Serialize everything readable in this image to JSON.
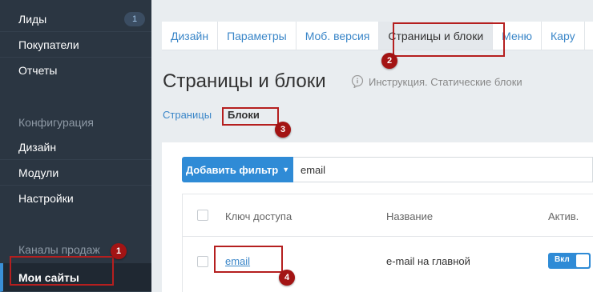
{
  "sidebar": {
    "items": [
      {
        "label": "Лиды",
        "badge": "1"
      },
      {
        "label": "Покупатели"
      },
      {
        "label": "Отчеты"
      },
      {
        "label": "Конфигурация"
      },
      {
        "label": "Дизайн"
      },
      {
        "label": "Модули"
      },
      {
        "label": "Настройки"
      },
      {
        "label": "Каналы продаж"
      },
      {
        "label": "Мои сайты"
      }
    ]
  },
  "tabs": [
    "Дизайн",
    "Параметры",
    "Моб. версия",
    "Страницы и блоки",
    "Меню",
    "Кару"
  ],
  "page": {
    "title": "Страницы и блоки",
    "help_text": "Инструкция. Статические блоки"
  },
  "subtabs": {
    "pages": "Страницы",
    "blocks": "Блоки"
  },
  "filter": {
    "button_label": "Добавить фильтр",
    "value": "email"
  },
  "table": {
    "headers": {
      "key": "Ключ доступа",
      "name": "Название",
      "active": "Актив."
    },
    "rows": [
      {
        "key": "email",
        "name": "e-mail на главной",
        "active_label": "Вкл"
      }
    ]
  },
  "annotations": {
    "m1": "1",
    "m2": "2",
    "m3": "3",
    "m4": "4"
  },
  "colors": {
    "accent": "#2f8bd6",
    "sidebar": "#2b3642",
    "annotation": "#b51f1f"
  }
}
